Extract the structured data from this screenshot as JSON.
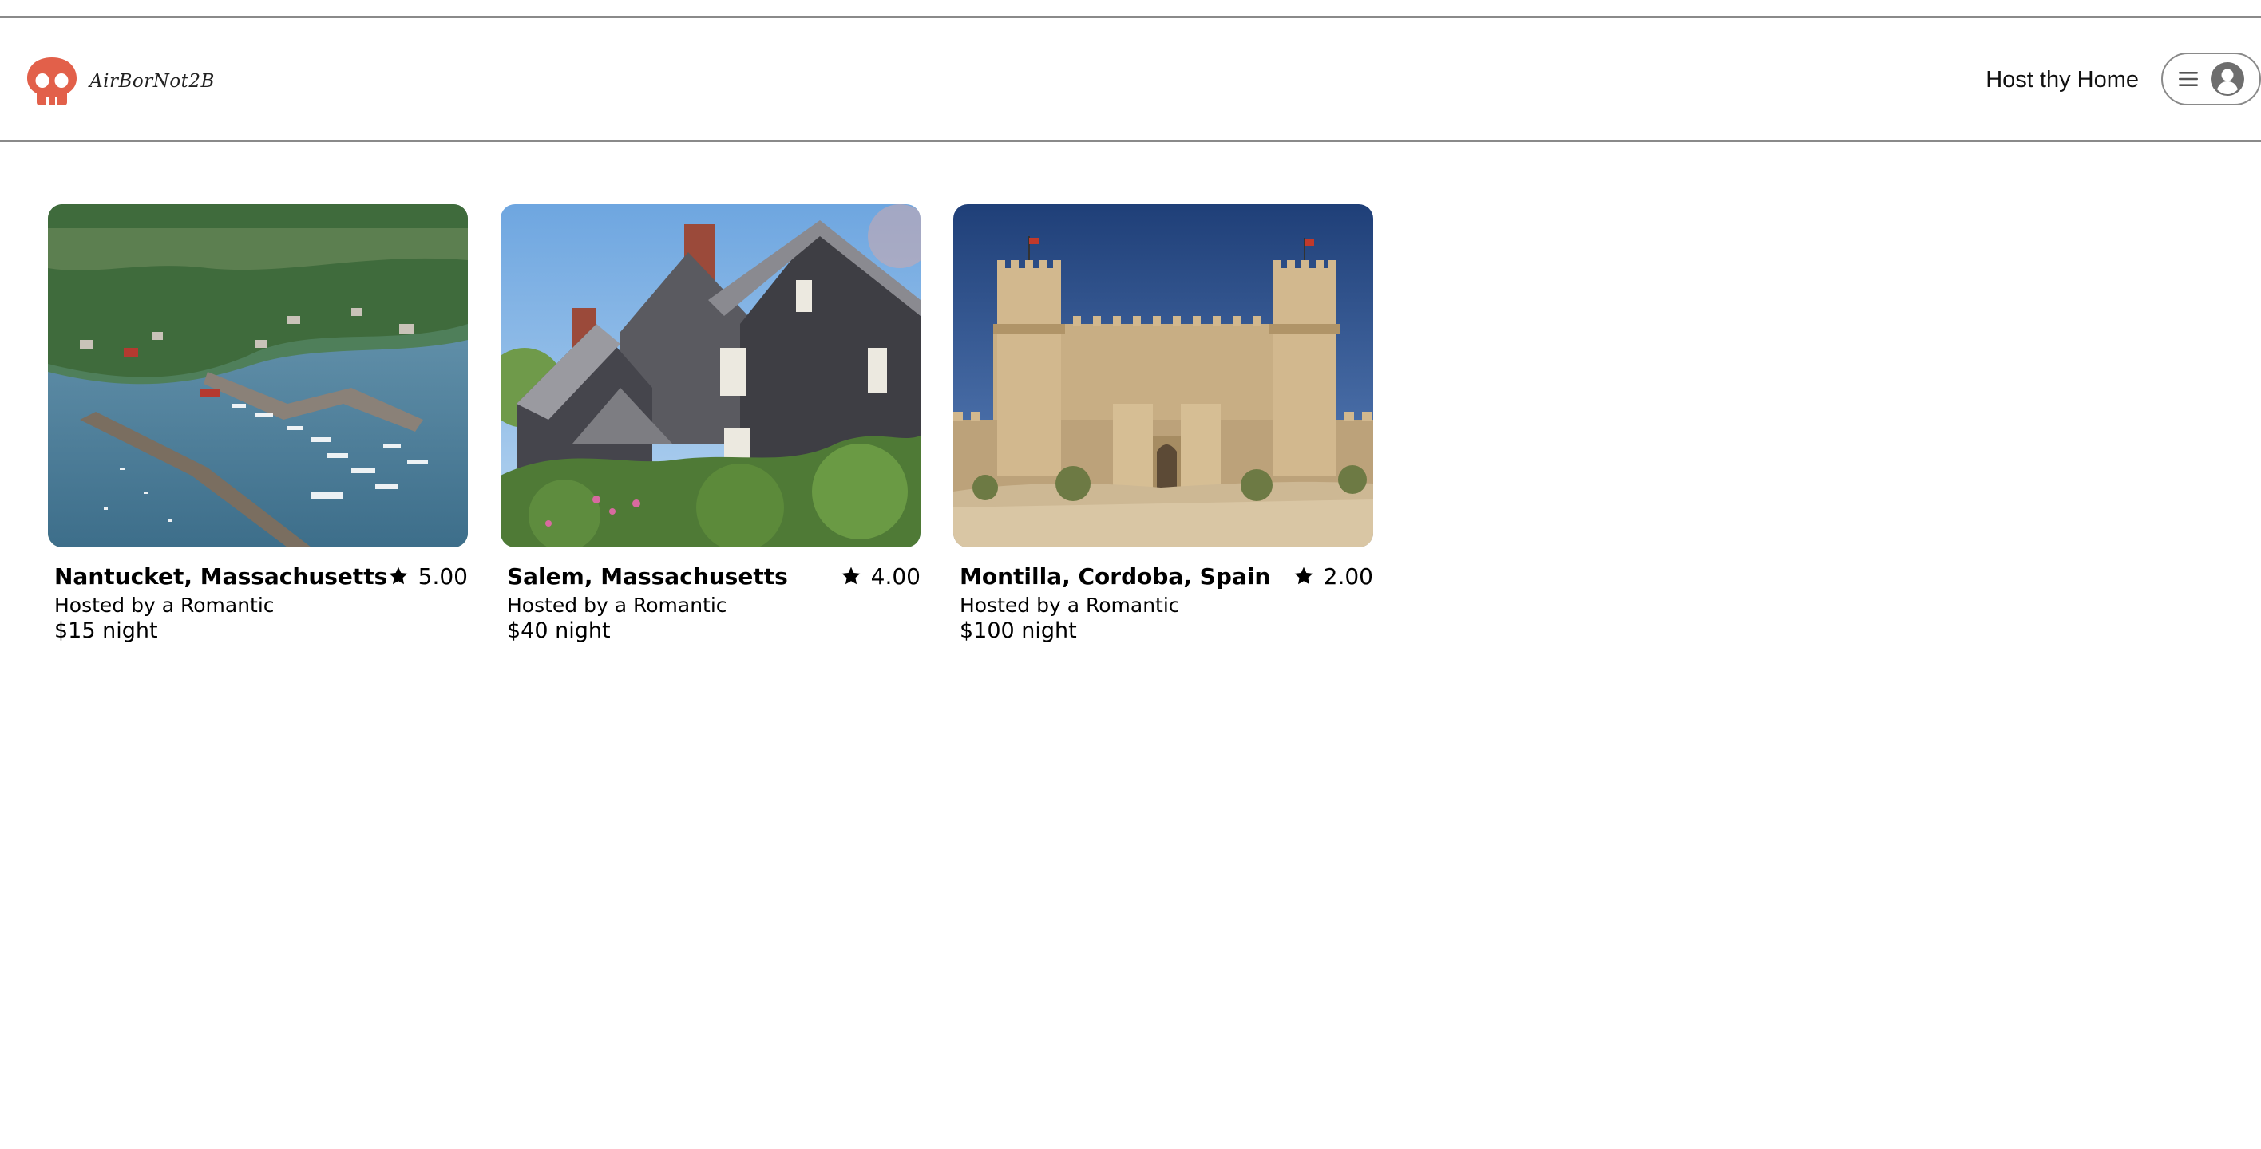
{
  "header": {
    "logo_text": "AirBorNot2B",
    "logo_icon": "skull-icon",
    "host_link": "Host thy Home",
    "menu_icon": "hamburger-menu-icon",
    "profile_icon": "user-avatar-icon"
  },
  "colors": {
    "brand": "#e2604a",
    "rule": "#8a8a8a",
    "text": "#000000"
  },
  "listings": [
    {
      "title": "Nantucket, Massachusetts",
      "rating": "5.00",
      "host": "Hosted by a Romantic",
      "price": "$15 night",
      "image": "harbor-aerial-photo"
    },
    {
      "title": "Salem, Massachusetts",
      "rating": "4.00",
      "host": "Hosted by a Romantic",
      "price": "$40 night",
      "image": "gabled-house-photo"
    },
    {
      "title": "Montilla, Cordoba, Spain",
      "rating": "2.00",
      "host": "Hosted by a Romantic",
      "price": "$100 night",
      "image": "castle-photo"
    }
  ]
}
